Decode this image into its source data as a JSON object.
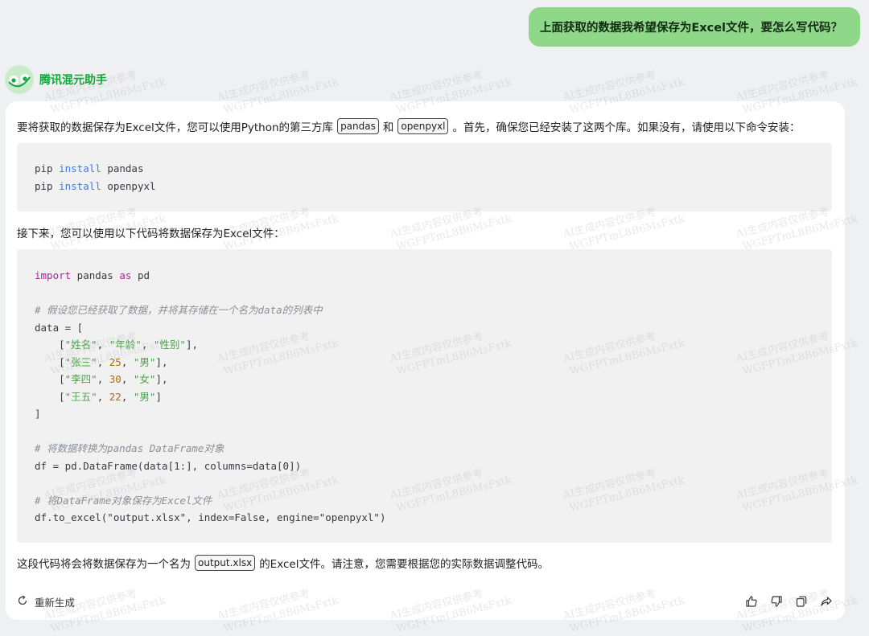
{
  "user_message": "上面获取的数据我希望保存为Excel文件，要怎么写代码？",
  "bot": {
    "name": "腾讯混元助手",
    "intro": {
      "before": "要将获取的数据保存为Excel文件，您可以使用Python的第三方库",
      "lib1": "pandas",
      "and": "和",
      "lib2": "openpyxl",
      "after": "。首先，确保您已经安装了这两个库。如果没有，请使用以下命令安装："
    },
    "install_code": [
      {
        "pre": "pip ",
        "kw": "install",
        "post": " pandas"
      },
      {
        "pre": "pip ",
        "kw": "install",
        "post": " openpyxl"
      }
    ],
    "next_text": "接下来，您可以使用以下代码将数据保存为Excel文件：",
    "code": {
      "import_kw": "import",
      "import_mod": " pandas ",
      "as_kw": "as",
      "alias": " pd",
      "comment1": "# 假设您已经获取了数据，并将其存储在一个名为data的列表中",
      "data_open": "data = [",
      "rows": [
        [
          "\"姓名\"",
          "\"年龄\"",
          "\"性别\""
        ],
        [
          "\"张三\"",
          "25",
          "\"男\""
        ],
        [
          "\"李四\"",
          "30",
          "\"女\""
        ],
        [
          "\"王五\"",
          "22",
          "\"男\""
        ]
      ],
      "data_close": "]",
      "comment2": "# 将数据转换为pandas DataFrame对象",
      "df_line": "df = pd.DataFrame(data[1:], columns=data[0])",
      "comment3": "# 将DataFrame对象保存为Excel文件",
      "save_line": "df.to_excel(\"output.xlsx\", index=False, engine=\"openpyxl\")"
    },
    "outro": {
      "before": "这段代码将会将数据保存为一个名为",
      "file": "output.xlsx",
      "after": "的Excel文件。请注意，您需要根据您的实际数据调整代码。"
    },
    "regenerate_label": "重新生成",
    "watermark_line1": "AI生成内容仅供参考",
    "watermark_line2": "WGFPTmL8B6MsFxtk"
  },
  "colors": {
    "user_bubble": "#8fd88a",
    "bot_name": "#13a536",
    "code_bg": "#f1f1f2",
    "page_bg": "#eef0f3"
  },
  "icons": [
    "thumbs-up-icon",
    "thumbs-down-icon",
    "copy-icon",
    "share-icon",
    "refresh-icon"
  ]
}
